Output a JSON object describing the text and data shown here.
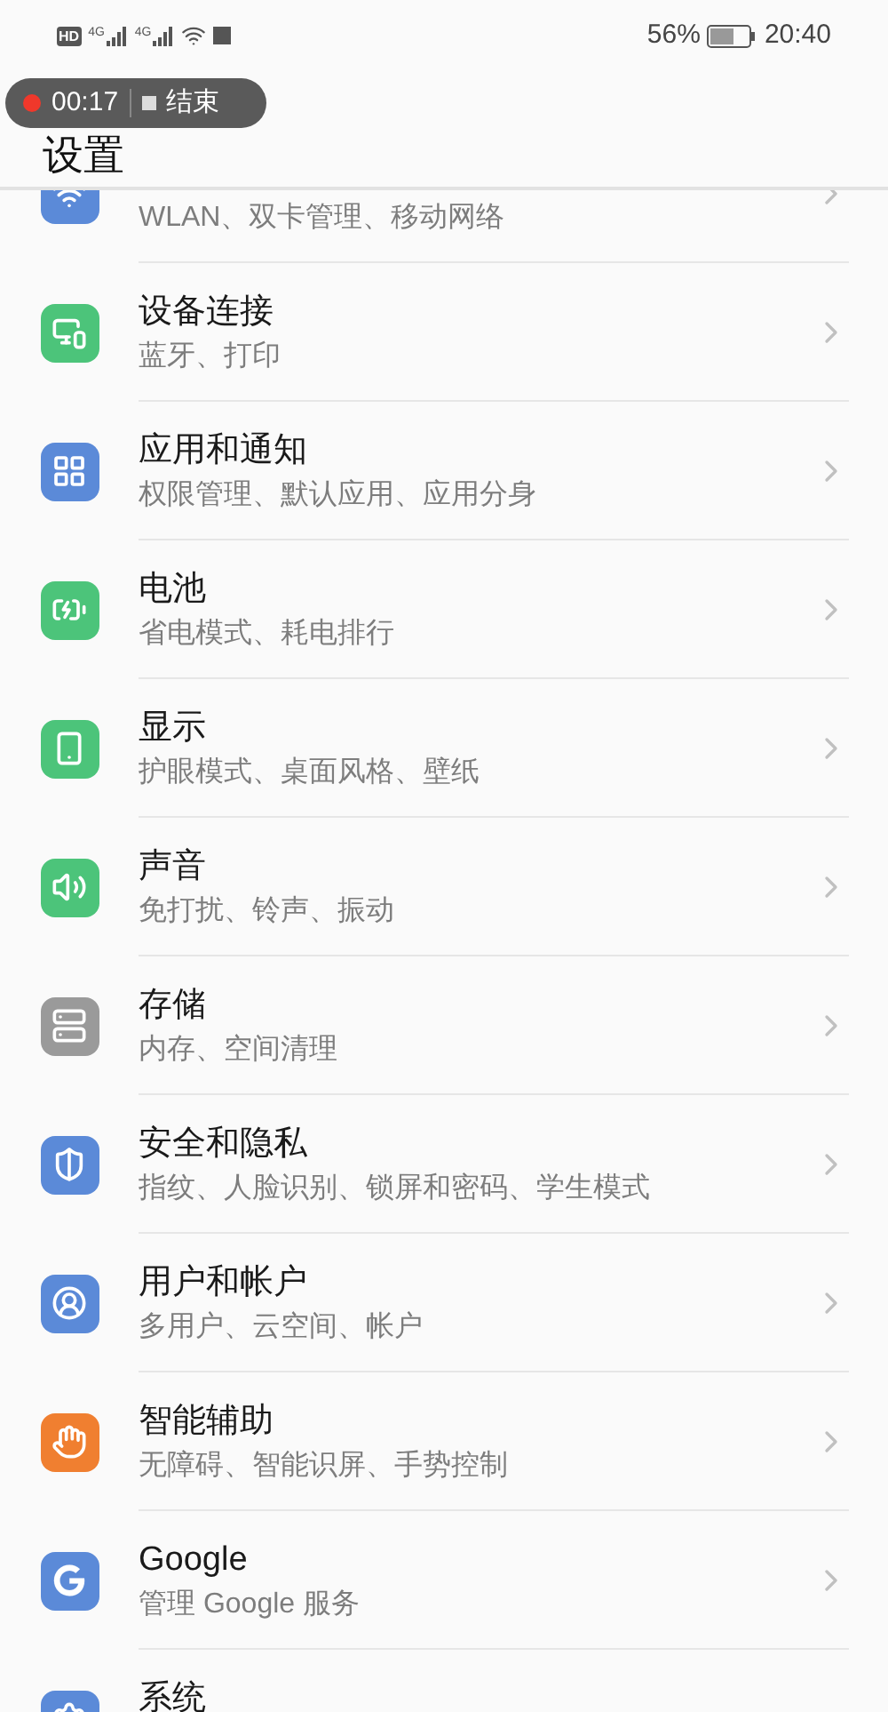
{
  "status_bar": {
    "hd": "HD",
    "networks": [
      "4G",
      "4G"
    ],
    "battery": "56%",
    "time": "20:40"
  },
  "recording": {
    "time": "00:17",
    "stop": "结束"
  },
  "title": "设置",
  "items": [
    {
      "kind": "wifi",
      "color": "#5b8ad8",
      "subtitle": "WLAN、双卡管理、移动网络"
    },
    {
      "kind": "devices",
      "color": "#4cc47a",
      "title": "设备连接",
      "subtitle": "蓝牙、打印"
    },
    {
      "kind": "apps",
      "color": "#5b8ad8",
      "title": "应用和通知",
      "subtitle": "权限管理、默认应用、应用分身"
    },
    {
      "kind": "battery",
      "color": "#4cc47a",
      "title": "电池",
      "subtitle": "省电模式、耗电排行"
    },
    {
      "kind": "display",
      "color": "#4cc47a",
      "title": "显示",
      "subtitle": "护眼模式、桌面风格、壁纸"
    },
    {
      "kind": "sound",
      "color": "#4cc47a",
      "title": "声音",
      "subtitle": "免打扰、铃声、振动"
    },
    {
      "kind": "storage",
      "color": "#9a9a9a",
      "title": "存储",
      "subtitle": "内存、空间清理"
    },
    {
      "kind": "security",
      "color": "#5b8ad8",
      "title": "安全和隐私",
      "subtitle": "指纹、人脸识别、锁屏和密码、学生模式"
    },
    {
      "kind": "user",
      "color": "#5b8ad8",
      "title": "用户和帐户",
      "subtitle": "多用户、云空间、帐户"
    },
    {
      "kind": "hand",
      "color": "#f07f30",
      "title": "智能辅助",
      "subtitle": "无障碍、智能识屏、手势控制"
    },
    {
      "kind": "google",
      "color": "#5b8ad8",
      "title": "Google",
      "subtitle": "管理 Google 服务"
    },
    {
      "kind": "system",
      "color": "#5b8ad8",
      "title": "系统"
    }
  ]
}
